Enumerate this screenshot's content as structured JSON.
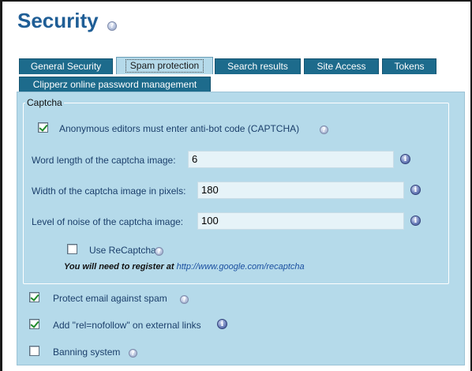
{
  "page": {
    "title": "Security"
  },
  "tabs": [
    {
      "label": "General Security",
      "active": false
    },
    {
      "label": "Spam protection",
      "active": true
    },
    {
      "label": "Search results",
      "active": false
    },
    {
      "label": "Site Access",
      "active": false
    },
    {
      "label": "Tokens",
      "active": false
    },
    {
      "label": "Clipperz online password management",
      "active": false
    }
  ],
  "captcha": {
    "legend": "Captcha",
    "anonymous_editors": {
      "label": "Anonymous editors must enter anti-bot code (CAPTCHA)",
      "checked": true
    },
    "word_length": {
      "label": "Word length of the captcha image:",
      "value": "6"
    },
    "width": {
      "label": "Width of the captcha image in pixels:",
      "value": "180"
    },
    "noise": {
      "label": "Level of noise of the captcha image:",
      "value": "100"
    },
    "recaptcha": {
      "label": "Use ReCaptcha",
      "checked": false,
      "note": "You will need to register at",
      "link": "http://www.google.com/recaptcha"
    }
  },
  "options": {
    "protect_email": {
      "label": "Protect email against spam",
      "checked": true
    },
    "nofollow": {
      "label": "Add \"rel=nofollow\" on external links",
      "checked": true
    },
    "banning": {
      "label": "Banning system",
      "checked": false
    }
  },
  "colors": {
    "title": "#1f5e96",
    "tab_bg": "#1d6b8c",
    "panel_bg": "#b5daea",
    "input_bg": "#e6f3f8"
  }
}
